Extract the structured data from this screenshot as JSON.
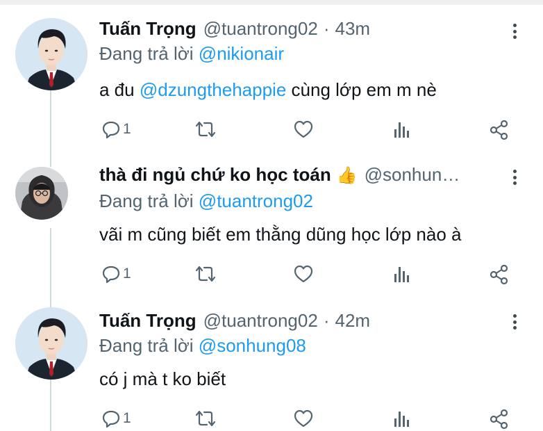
{
  "tweets": [
    {
      "name": "Tuấn Trọng",
      "emoji": "",
      "handle": "@tuantrong02",
      "separator": "·",
      "time": "43m",
      "replying_prefix": "Đang trả lời",
      "replying_to": "@nikionair",
      "text_before": "a đu",
      "text_mention": "@dzungthehappie",
      "text_after": "cùng lớp em m nè",
      "reply_count": "1",
      "avatar_icon": "avatar-suit-icon"
    },
    {
      "name": "thà đi ngủ chứ ko học toán",
      "emoji": "👍",
      "handle": "@sonhungxxx",
      "separator": "",
      "time": "",
      "replying_prefix": "Đang trả lời",
      "replying_to": "@tuantrong02",
      "text_before": "vãi m cũng biết em thằng dũng học lớp nào à",
      "text_mention": "",
      "text_after": "",
      "reply_count": "1",
      "avatar_icon": "avatar-hoodie-icon"
    },
    {
      "name": "Tuấn Trọng",
      "emoji": "",
      "handle": "@tuantrong02",
      "separator": "·",
      "time": "42m",
      "replying_prefix": "Đang trả lời",
      "replying_to": "@sonhung08",
      "text_before": "có j mà t ko biết",
      "text_mention": "",
      "text_after": "",
      "reply_count": "1",
      "avatar_icon": "avatar-suit-icon"
    }
  ],
  "colors": {
    "accent": "#1d9bf0",
    "secondary_text": "#536471",
    "primary_text": "#0f1419",
    "thread_line": "#cfd9de",
    "icon": "#536471"
  },
  "action_icons": [
    "reply-icon",
    "retweet-icon",
    "like-icon",
    "analytics-icon",
    "share-icon"
  ]
}
